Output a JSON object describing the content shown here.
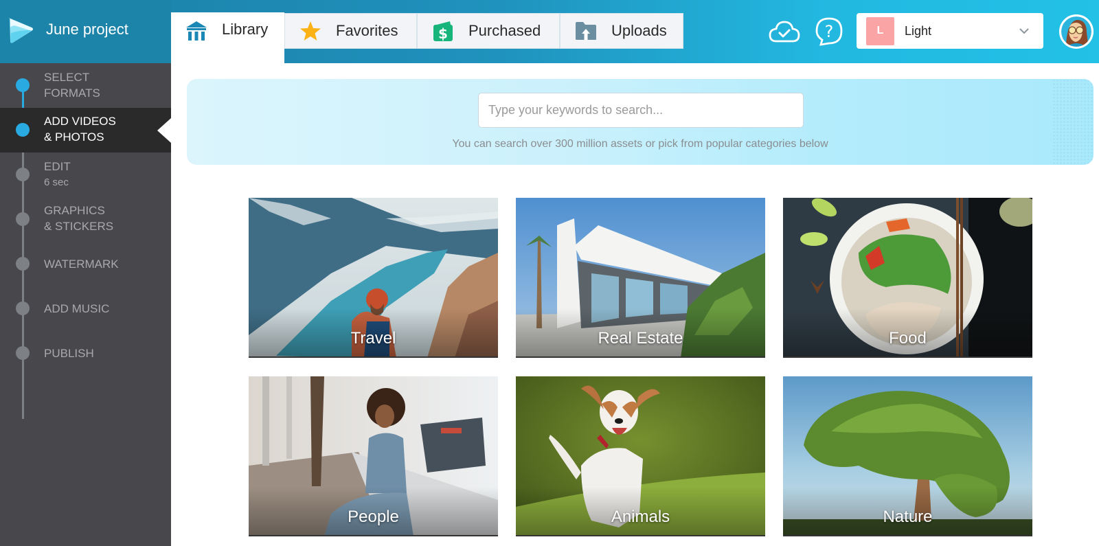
{
  "header": {
    "project_title": "June project",
    "tabs": [
      {
        "label": "Library",
        "icon": "library-icon",
        "active": true
      },
      {
        "label": "Favorites",
        "icon": "star-icon",
        "active": false
      },
      {
        "label": "Purchased",
        "icon": "purchased-wallet-icon",
        "active": false
      },
      {
        "label": "Uploads",
        "icon": "upload-folder-icon",
        "active": false
      }
    ],
    "cloud_icon": "cloud-check-icon",
    "help_icon": "help-question-icon",
    "theme_select": {
      "swatch_letter": "L",
      "selected": "Light",
      "swatch_color": "#fba4a6"
    },
    "avatar": "user-avatar"
  },
  "sidebar": {
    "steps": [
      {
        "label": "SELECT",
        "label2": "FORMATS",
        "sub": "",
        "state": "done"
      },
      {
        "label": "ADD VIDEOS",
        "label2": "& PHOTOS",
        "sub": "",
        "state": "active"
      },
      {
        "label": "EDIT",
        "label2": "",
        "sub": "6 sec",
        "state": "pending"
      },
      {
        "label": "GRAPHICS",
        "label2": "& STICKERS",
        "sub": "",
        "state": "pending"
      },
      {
        "label": "WATERMARK",
        "label2": "",
        "sub": "",
        "state": "pending"
      },
      {
        "label": "ADD MUSIC",
        "label2": "",
        "sub": "",
        "state": "pending"
      },
      {
        "label": "PUBLISH",
        "label2": "",
        "sub": "",
        "state": "pending"
      }
    ]
  },
  "search": {
    "value": "",
    "placeholder": "Type your keywords to search...",
    "hint": "You can search over 300 million assets or pick from popular categories below"
  },
  "categories": [
    {
      "label": "Travel"
    },
    {
      "label": "Real Estate"
    },
    {
      "label": "Food"
    },
    {
      "label": "People"
    },
    {
      "label": "Animals"
    },
    {
      "label": "Nature"
    }
  ],
  "colors": {
    "header_accent": "#1f92bd",
    "sidebar_bg": "#48474c",
    "active_step_bg": "#2a2a2a",
    "step_done": "#29abe2",
    "step_pending": "#7d8084"
  }
}
